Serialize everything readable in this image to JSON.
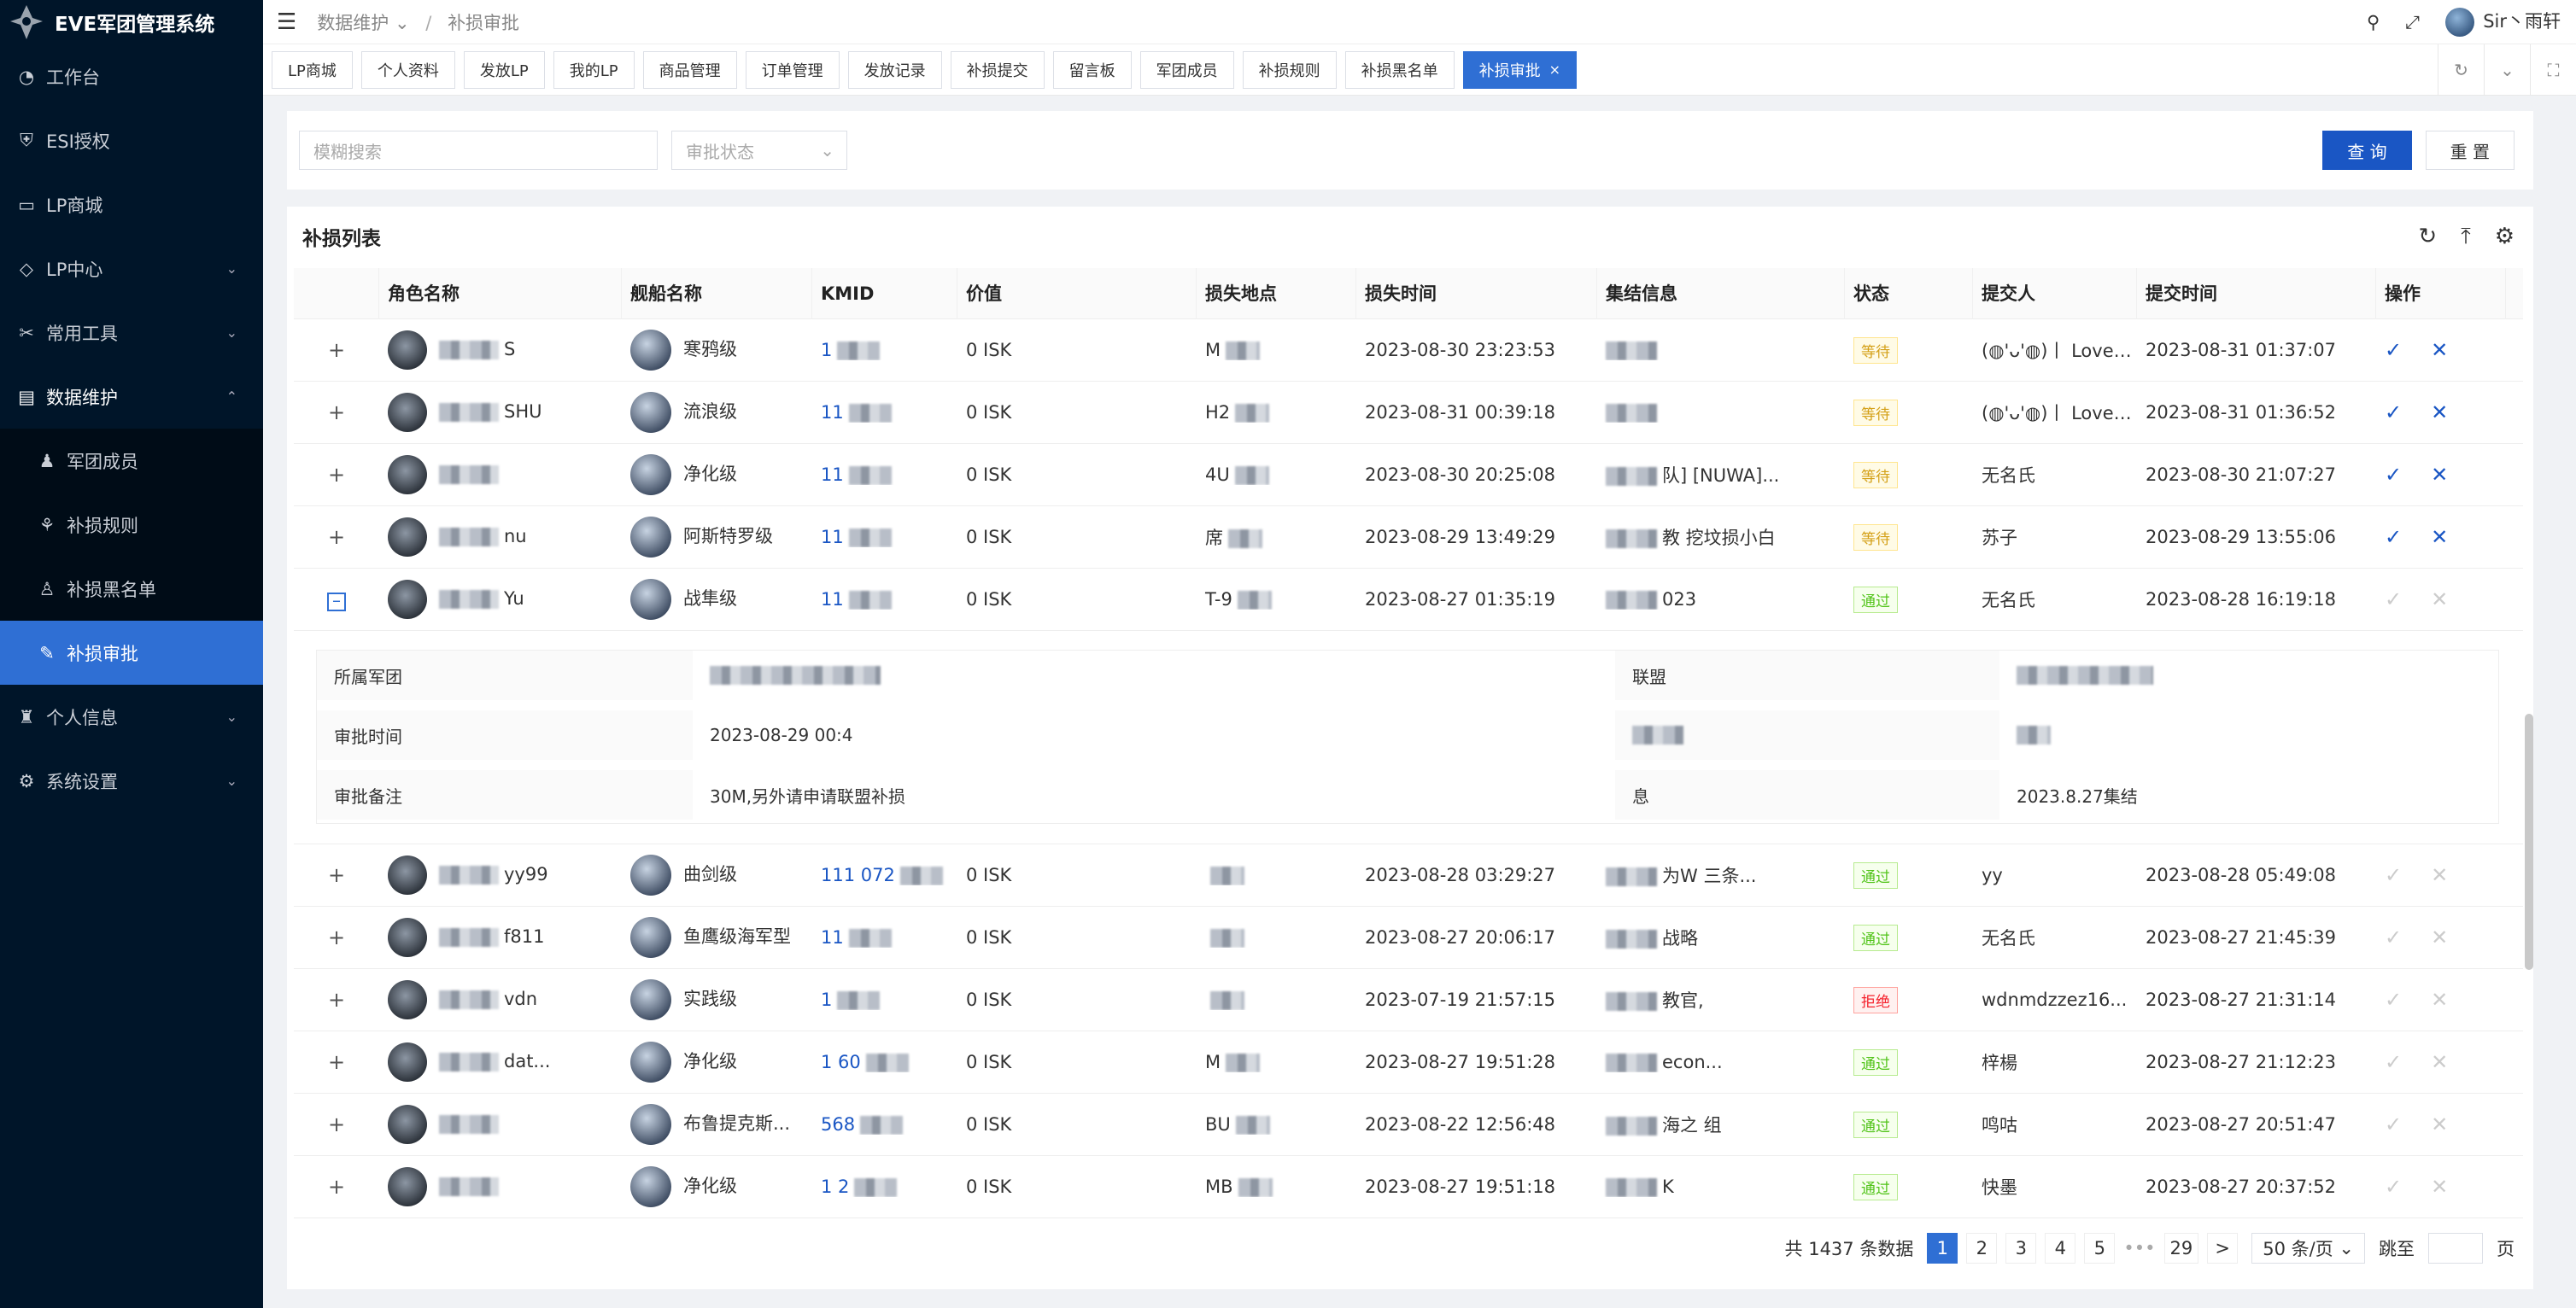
{
  "app": {
    "title": "EVE军团管理系统"
  },
  "sider": {
    "items": [
      {
        "label": "工作台",
        "icon": "dashboard-icon",
        "arrow": ""
      },
      {
        "label": "ESI授权",
        "icon": "shield-icon",
        "arrow": ""
      },
      {
        "label": "LP商城",
        "icon": "shop-icon",
        "arrow": ""
      },
      {
        "label": "LP中心",
        "icon": "tag-icon",
        "arrow": "⌄"
      },
      {
        "label": "常用工具",
        "icon": "tools-icon",
        "arrow": "⌄"
      },
      {
        "label": "数据维护",
        "icon": "grid-icon",
        "arrow": "⌃"
      }
    ],
    "sub": [
      {
        "label": "军团成员",
        "icon": "user-icon"
      },
      {
        "label": "补损规则",
        "icon": "rule-icon"
      },
      {
        "label": "补损黑名单",
        "icon": "users-icon"
      },
      {
        "label": "补损审批",
        "icon": "doc-icon"
      }
    ],
    "bottom": [
      {
        "label": "个人信息",
        "icon": "person-icon",
        "arrow": "⌄"
      },
      {
        "label": "系统设置",
        "icon": "gear-icon",
        "arrow": "⌄"
      }
    ]
  },
  "header": {
    "crumb1": "数据维护",
    "crumb2": "补损审批",
    "user": "Sir丶雨轩"
  },
  "tabs": [
    "LP商城",
    "个人资料",
    "发放LP",
    "我的LP",
    "商品管理",
    "订单管理",
    "发放记录",
    "补损提交",
    "留言板",
    "军团成员",
    "补损规则",
    "补损黑名单",
    "补损审批"
  ],
  "search": {
    "keyword_placeholder": "模糊搜索",
    "status_placeholder": "审批状态",
    "query": "查 询",
    "reset": "重 置"
  },
  "table": {
    "title": "补损列表",
    "columns": [
      "角色名称",
      "舰船名称",
      "KMID",
      "价值",
      "损失地点",
      "损失时间",
      "集结信息",
      "状态",
      "提交人",
      "提交时间",
      "操作"
    ],
    "rows": [
      {
        "char": "S",
        "ship": "寒鸦级",
        "kmid": "1",
        "value": "0 ISK",
        "place": "M",
        "ltime": "2023-08-30 23:23:53",
        "fleet": "",
        "status": "等待",
        "stype": "wait",
        "submitter": "(◍'ᴗ'◍)丨 Love…",
        "stime": "2023-08-31 01:37:07",
        "active": true
      },
      {
        "char": "SHU",
        "ship": "流浪级",
        "kmid": "11",
        "value": "0 ISK",
        "place": "H2",
        "ltime": "2023-08-31 00:39:18",
        "fleet": "",
        "status": "等待",
        "stype": "wait",
        "submitter": "(◍'ᴗ'◍)丨 Love…",
        "stime": "2023-08-31 01:36:52",
        "active": true
      },
      {
        "char": "",
        "ship": "净化级",
        "kmid": "11",
        "value": "0 ISK",
        "place": "4U",
        "ltime": "2023-08-30 20:25:08",
        "fleet": "队] [NUWA]...",
        "status": "等待",
        "stype": "wait",
        "submitter": "无名氏",
        "stime": "2023-08-30 21:07:27",
        "active": true
      },
      {
        "char": "nu",
        "ship": "阿斯特罗级",
        "kmid": "11",
        "value": "0 ISK",
        "place": "席",
        "ltime": "2023-08-29 13:49:29",
        "fleet": "教 挖坟损小白",
        "status": "等待",
        "stype": "wait",
        "submitter": "苏子",
        "stime": "2023-08-29 13:55:06",
        "active": true
      },
      {
        "char": "Yu",
        "ship": "战隼级",
        "kmid": "11",
        "value": "0 ISK",
        "place": "T-9",
        "ltime": "2023-08-27 01:35:19",
        "fleet": "023",
        "status": "通过",
        "stype": "pass",
        "submitter": "无名氏",
        "stime": "2023-08-28 16:19:18",
        "active": false,
        "expanded": true
      },
      {
        "char": "yy99",
        "ship": "曲剑级",
        "kmid": "111 072",
        "value": "0 ISK",
        "place": "",
        "ltime": "2023-08-28 03:29:27",
        "fleet": "为W 三条...",
        "status": "通过",
        "stype": "pass",
        "submitter": "yy",
        "stime": "2023-08-28 05:49:08",
        "active": false
      },
      {
        "char": "f811",
        "ship": "鱼鹰级海军型",
        "kmid": "11",
        "value": "0 ISK",
        "place": "",
        "ltime": "2023-08-27 20:06:17",
        "fleet": "战略",
        "status": "通过",
        "stype": "pass",
        "submitter": "无名氏",
        "stime": "2023-08-27 21:45:39",
        "active": false
      },
      {
        "char": "vdn",
        "ship": "实践级",
        "kmid": "1",
        "value": "0 ISK",
        "place": "",
        "ltime": "2023-07-19 21:57:15",
        "fleet": "教官,",
        "status": "拒绝",
        "stype": "reject",
        "submitter": "wdnmdzzez16...",
        "stime": "2023-08-27 21:31:14",
        "active": false
      },
      {
        "char": "dat...",
        "ship": "净化级",
        "kmid": "1 60",
        "value": "0 ISK",
        "place": "M",
        "ltime": "2023-08-27 19:51:28",
        "fleet": "econ...",
        "status": "通过",
        "stype": "pass",
        "submitter": "梓楊",
        "stime": "2023-08-27 21:12:23",
        "active": false
      },
      {
        "char": "",
        "ship": "布鲁提克斯...",
        "kmid": "568",
        "value": "0 ISK",
        "place": "BU",
        "ltime": "2023-08-22 12:56:48",
        "fleet": "海之 组",
        "status": "通过",
        "stype": "pass",
        "submitter": "鸣咕",
        "stime": "2023-08-27 20:51:47",
        "active": false
      },
      {
        "char": "",
        "ship": "净化级",
        "kmid": "1 2",
        "value": "0 ISK",
        "place": "MB",
        "ltime": "2023-08-27 19:51:18",
        "fleet": "K",
        "status": "通过",
        "stype": "pass",
        "submitter": "快墨",
        "stime": "2023-08-27 20:37:52",
        "active": false
      }
    ],
    "detail": {
      "label1": "所属军团",
      "label2": "审批时间",
      "label3": "审批备注",
      "v2": "2023-08-29 00:4",
      "v3": "30M,另外请申请联盟补损",
      "label4": "联盟",
      "label6": "息",
      "v6": "2023.8.27集结"
    }
  },
  "pager": {
    "total": "共 1437 条数据",
    "pages": [
      "1",
      "2",
      "3",
      "4",
      "5"
    ],
    "ellipsis": "•••",
    "last": "29",
    "next": ">",
    "size": "50 条/页",
    "jump": "跳至",
    "page_unit": "页"
  }
}
